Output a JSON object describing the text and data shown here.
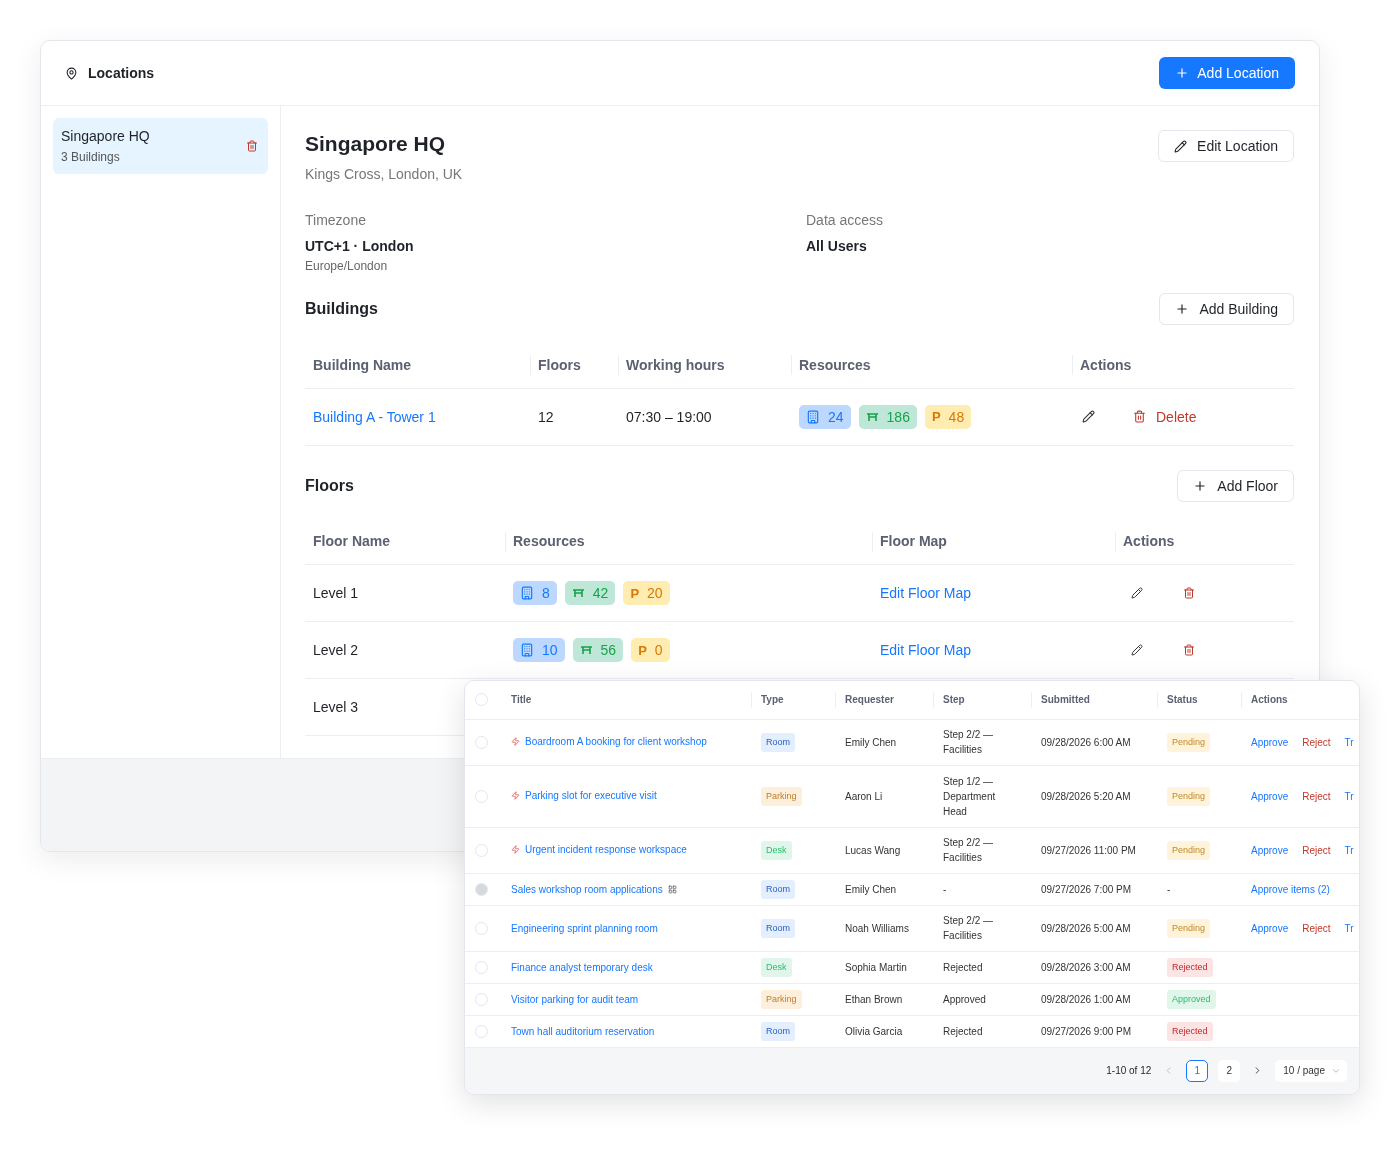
{
  "header": {
    "title": "Locations",
    "add_button": "Add Location"
  },
  "sidebar": {
    "items": [
      {
        "name": "Singapore HQ",
        "subtitle": "3 Buildings",
        "selected": true
      }
    ]
  },
  "location": {
    "name": "Singapore HQ",
    "address": "Kings Cross, London, UK",
    "edit_button": "Edit Location",
    "fields": [
      {
        "label": "Timezone",
        "value": "UTC+1 · London",
        "note": "Europe/London"
      },
      {
        "label": "Data access",
        "value": "All Users"
      }
    ]
  },
  "buildings": {
    "title": "Buildings",
    "add_button": "Add Building",
    "columns": [
      "Building Name",
      "Floors",
      "Working hours",
      "Resources",
      "Actions"
    ],
    "rows": [
      {
        "name": "Building A - Tower 1",
        "floors": "12",
        "hours": "07:30 – 19:00",
        "resources": [
          {
            "kind": "building",
            "count": "24"
          },
          {
            "kind": "desk",
            "count": "186"
          },
          {
            "kind": "parking",
            "glyph": "P",
            "count": "48"
          }
        ],
        "delete_label": "Delete"
      }
    ]
  },
  "floors": {
    "title": "Floors",
    "add_button": "Add Floor",
    "columns": [
      "Floor Name",
      "Resources",
      "Floor Map",
      "Actions"
    ],
    "rows": [
      {
        "name": "Level 1",
        "resources": [
          {
            "kind": "building",
            "count": "8"
          },
          {
            "kind": "desk",
            "count": "42"
          },
          {
            "kind": "parking",
            "glyph": "P",
            "count": "20"
          }
        ],
        "map_link": "Edit Floor Map",
        "actions": [
          {
            "kind": "edit"
          },
          {
            "kind": "delete"
          }
        ]
      },
      {
        "name": "Level 2",
        "resources": [
          {
            "kind": "building",
            "count": "10"
          },
          {
            "kind": "desk",
            "count": "56"
          },
          {
            "kind": "parking",
            "glyph": "P",
            "count": "0"
          }
        ],
        "map_link": "Edit Floor Map",
        "actions": [
          {
            "kind": "edit"
          },
          {
            "kind": "delete"
          }
        ]
      },
      {
        "name": "Level 3"
      }
    ]
  },
  "requests": {
    "select_all": {
      "checked": false
    },
    "columns": [
      "Title",
      "Type",
      "Requester",
      "Step",
      "Submitted",
      "Status",
      "Actions"
    ],
    "rows": [
      {
        "title": "Boardroom A booking for client workshop",
        "urgent": true,
        "grouped": false,
        "disabled": false,
        "type": {
          "label": "Room",
          "color": "#e3eeff"
        },
        "requester": "Emily Chen",
        "step": "Step 2/2 — Facilities",
        "submitted": "09/28/2026 6:00 AM",
        "status": {
          "label": "Pending",
          "color": "#fff3dc"
        },
        "actions": [
          {
            "kind": "approve",
            "label": "Approve"
          },
          {
            "kind": "reject",
            "label": "Reject"
          },
          {
            "kind": "other",
            "label": "Tr"
          }
        ]
      },
      {
        "title": "Parking slot for executive visit",
        "urgent": true,
        "grouped": false,
        "disabled": false,
        "type": {
          "label": "Parking",
          "color": "#fdefdc"
        },
        "requester": "Aaron Li",
        "step": "Step 1/2 — Department Head",
        "submitted": "09/28/2026 5:20 AM",
        "status": {
          "label": "Pending",
          "color": "#fff3dc"
        },
        "actions": [
          {
            "kind": "approve",
            "label": "Approve"
          },
          {
            "kind": "reject",
            "label": "Reject"
          },
          {
            "kind": "other",
            "label": "Tr"
          }
        ]
      },
      {
        "title": "Urgent incident response workspace",
        "urgent": true,
        "grouped": false,
        "disabled": false,
        "type": {
          "label": "Desk",
          "color": "#e0f6ea"
        },
        "requester": "Lucas Wang",
        "step": "Step 2/2 — Facilities",
        "submitted": "09/27/2026 11:00 PM",
        "status": {
          "label": "Pending",
          "color": "#fff3dc"
        },
        "actions": [
          {
            "kind": "approve",
            "label": "Approve"
          },
          {
            "kind": "reject",
            "label": "Reject"
          },
          {
            "kind": "other",
            "label": "Tr"
          }
        ]
      },
      {
        "title": "Sales workshop room applications",
        "urgent": false,
        "grouped": true,
        "disabled": true,
        "type": {
          "label": "Room",
          "color": "#e3eeff"
        },
        "requester": "Emily Chen",
        "step": "-",
        "submitted": "09/27/2026 7:00 PM",
        "status": {
          "label": "-"
        },
        "actions": [
          {
            "kind": "approve",
            "label": "Approve items (2)"
          }
        ]
      },
      {
        "title": "Engineering sprint planning room",
        "urgent": false,
        "grouped": false,
        "disabled": false,
        "type": {
          "label": "Room",
          "color": "#e3eeff"
        },
        "requester": "Noah Williams",
        "step": "Step 2/2 — Facilities",
        "submitted": "09/28/2026 5:00 AM",
        "status": {
          "label": "Pending",
          "color": "#fff3dc"
        },
        "actions": [
          {
            "kind": "approve",
            "label": "Approve"
          },
          {
            "kind": "reject",
            "label": "Reject"
          },
          {
            "kind": "other",
            "label": "Tr"
          }
        ]
      },
      {
        "title": "Finance analyst temporary desk",
        "urgent": false,
        "grouped": false,
        "disabled": false,
        "type": {
          "label": "Desk",
          "color": "#e0f6ea"
        },
        "requester": "Sophia Martin",
        "step": "Rejected",
        "submitted": "09/28/2026 3:00 AM",
        "status": {
          "label": "Rejected",
          "color": "#fde4e4"
        }
      },
      {
        "title": "Visitor parking for audit team",
        "urgent": false,
        "grouped": false,
        "disabled": false,
        "type": {
          "label": "Parking",
          "color": "#fdefdc"
        },
        "requester": "Ethan Brown",
        "step": "Approved",
        "submitted": "09/28/2026 1:00 AM",
        "status": {
          "label": "Approved",
          "color": "#e0f6ea"
        }
      },
      {
        "title": "Town hall auditorium reservation",
        "urgent": false,
        "grouped": false,
        "disabled": false,
        "type": {
          "label": "Room",
          "color": "#e3eeff"
        },
        "requester": "Olivia Garcia",
        "step": "Rejected",
        "submitted": "09/27/2026 9:00 PM",
        "status": {
          "label": "Rejected",
          "color": "#fde4e4"
        }
      }
    ],
    "pagination": {
      "range": "1-10 of 12",
      "pages": [
        {
          "label": "1",
          "selected": true
        },
        {
          "label": "2",
          "selected": false
        }
      ],
      "page_size": "10 / page"
    }
  }
}
